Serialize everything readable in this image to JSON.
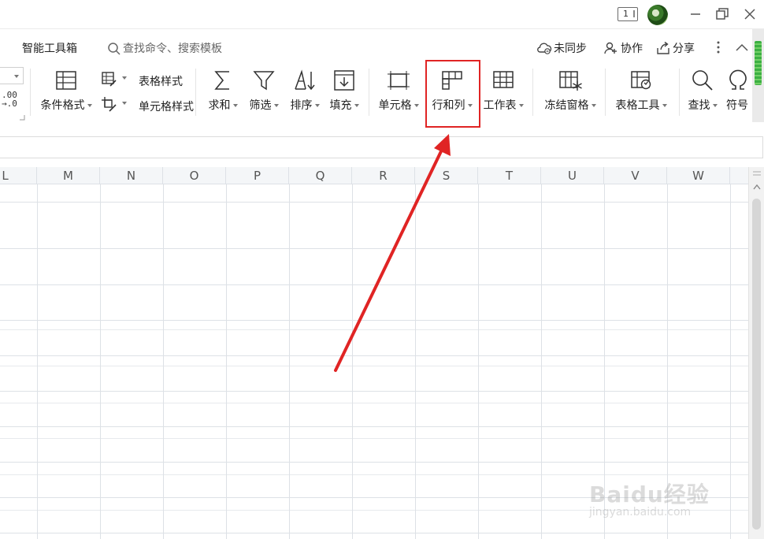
{
  "titlebar": {
    "badge": "1"
  },
  "tabs": {
    "smart_toolbox": "智能工具箱",
    "search_placeholder": "查找命令、搜索模板",
    "sync": "未同步",
    "collab": "协作",
    "share": "分享"
  },
  "toolbar": {
    "cond_format": "条件格式",
    "table_style": "表格样式",
    "cell_style": "单元格样式",
    "sum": "求和",
    "filter": "筛选",
    "sort": "排序",
    "fill": "填充",
    "cell": "单元格",
    "row_col": "行和列",
    "worksheet": "工作表",
    "freeze": "冻结窗格",
    "table_tools": "表格工具",
    "find": "查找",
    "symbol": "符号",
    "decimal_icon": ".00\n→.0"
  },
  "grid": {
    "columns": [
      "L",
      "M",
      "N",
      "O",
      "P",
      "Q",
      "R",
      "S",
      "T",
      "U",
      "V",
      "W"
    ]
  },
  "watermark": {
    "main": "Baidu经验",
    "sub": "jingyan.baidu.com"
  },
  "colors": {
    "annotation": "#e02424",
    "gridline": "#dde1e6",
    "header_bg": "#f4f6f8"
  }
}
